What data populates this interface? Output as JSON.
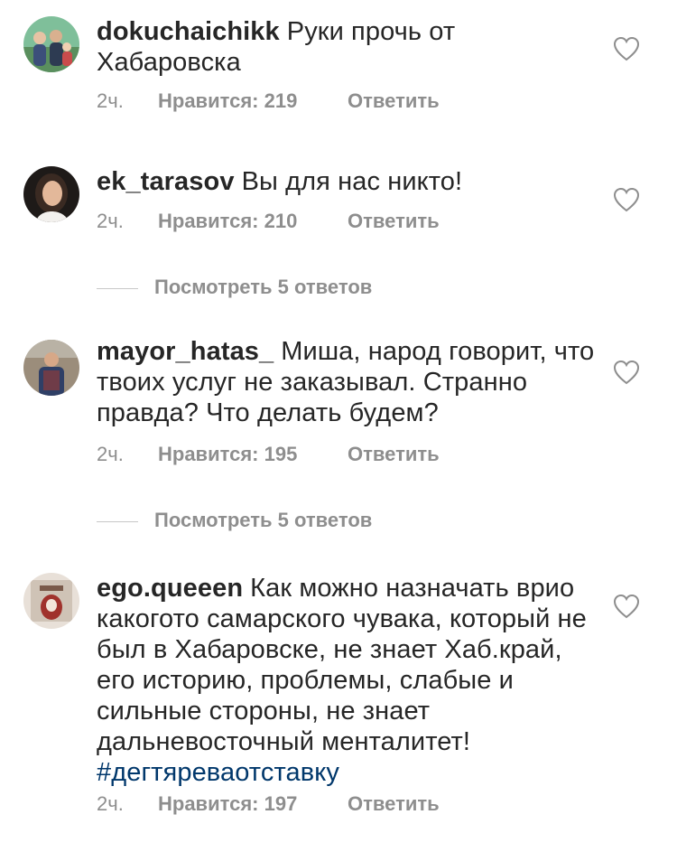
{
  "comments": [
    {
      "username": "dokuchaichikk",
      "text": "Руки прочь от Хабаровска",
      "hashtag": "",
      "time": "2ч.",
      "likes": "Нравится: 219",
      "reply": "Ответить"
    },
    {
      "username": "ek_tarasov",
      "text": "Вы для нас никто!",
      "hashtag": "",
      "time": "2ч.",
      "likes": "Нравится: 210",
      "reply": "Ответить",
      "view_replies": "Посмотреть 5 ответов"
    },
    {
      "username": "mayor_hatas_",
      "text": "Миша, народ говорит, что твоих услуг не заказывал. Странно правда? Что делать будем?",
      "hashtag": "",
      "time": "2ч.",
      "likes": "Нравится: 195",
      "reply": "Ответить",
      "view_replies": "Посмотреть 5 ответов"
    },
    {
      "username": "ego.queeen",
      "text": "Как можно назначать врио какогото самарского чувака, который не был в Хабаровске, не знает Хаб.край, его историю, проблемы, слабые и сильные стороны, не знает дальневосточный менталитет!",
      "hashtag": "#дегтяреваотставку",
      "time": "2ч.",
      "likes": "Нравится: 197",
      "reply": "Ответить"
    }
  ],
  "icons": {
    "like": "heart-outline-icon"
  },
  "colors": {
    "text": "#262626",
    "secondary": "#8e8e8e",
    "hashtag": "#00376b"
  }
}
